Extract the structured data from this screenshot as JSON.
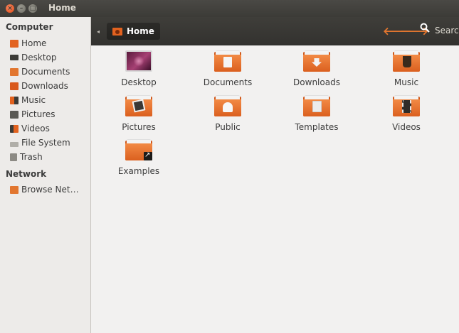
{
  "window": {
    "title": "Home"
  },
  "toolbar": {
    "breadcrumb": "Home",
    "back_icon": "arrow-left-icon",
    "forward_icon": "arrow-right-icon",
    "search_label": "Search"
  },
  "sidebar": {
    "computer_title": "Computer",
    "network_title": "Network",
    "items": [
      {
        "label": "Home",
        "icon": "home-folder-icon"
      },
      {
        "label": "Desktop",
        "icon": "desktop-icon"
      },
      {
        "label": "Documents",
        "icon": "documents-icon"
      },
      {
        "label": "Downloads",
        "icon": "downloads-icon"
      },
      {
        "label": "Music",
        "icon": "music-icon"
      },
      {
        "label": "Pictures",
        "icon": "pictures-icon"
      },
      {
        "label": "Videos",
        "icon": "videos-icon"
      },
      {
        "label": "File System",
        "icon": "drive-icon"
      },
      {
        "label": "Trash",
        "icon": "trash-icon"
      }
    ],
    "network_items": [
      {
        "label": "Browse Net…",
        "icon": "network-icon"
      }
    ]
  },
  "main": {
    "files": [
      {
        "label": "Desktop"
      },
      {
        "label": "Documents"
      },
      {
        "label": "Downloads"
      },
      {
        "label": "Music"
      },
      {
        "label": "Pictures"
      },
      {
        "label": "Public"
      },
      {
        "label": "Templates"
      },
      {
        "label": "Videos"
      },
      {
        "label": "Examples"
      }
    ]
  },
  "colors": {
    "accent": "#e2621f",
    "toolbar": "#3c3b37"
  }
}
